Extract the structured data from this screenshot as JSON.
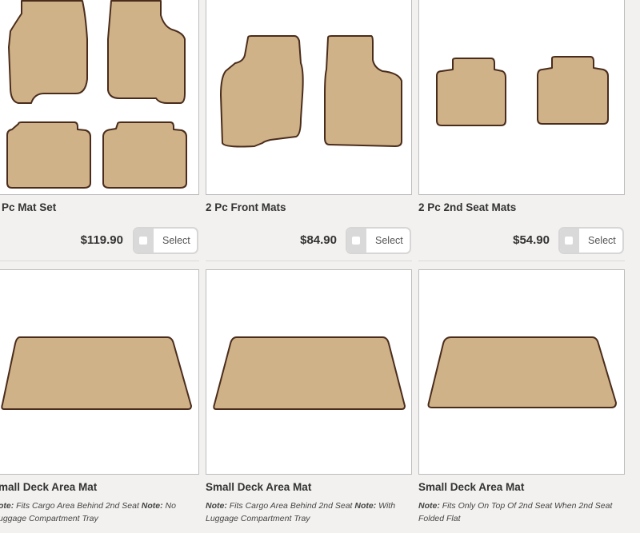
{
  "products": [
    {
      "title": "Pc Mat Set",
      "price": "$119.90",
      "select_label": "Select"
    },
    {
      "title": "2 Pc Front Mats",
      "price": "$84.90",
      "select_label": "Select"
    },
    {
      "title": "2 Pc 2nd Seat Mats",
      "price": "$54.90",
      "select_label": "Select"
    },
    {
      "title": "mall Deck Area Mat",
      "note_prefix": "ote:",
      "note_text_1": " Fits Cargo Area Behind 2nd Seat ",
      "note_label_2": "Note:",
      "note_text_2": " No",
      "note_line_2": "uggage Compartment Tray"
    },
    {
      "title": "Small Deck Area Mat",
      "note_prefix": "Note:",
      "note_text_1": " Fits Cargo Area Behind 2nd Seat ",
      "note_label_2": "Note:",
      "note_text_2": " With",
      "note_line_2": "Luggage Compartment Tray"
    },
    {
      "title": "Small Deck Area Mat",
      "note_prefix": "Note:",
      "note_text_1": " Fits Only On Top Of 2nd Seat When 2nd Seat",
      "note_line_2": "Folded Flat"
    }
  ],
  "colors": {
    "mat_fill": "#d0b288",
    "mat_stroke": "#4a2c1c",
    "background": "#f2f1ef"
  }
}
